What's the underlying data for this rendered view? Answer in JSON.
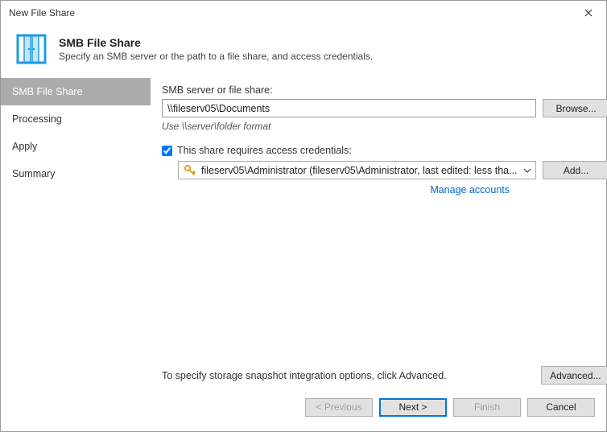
{
  "window": {
    "title": "New File Share"
  },
  "header": {
    "title": "SMB File Share",
    "subtitle": "Specify an SMB server or the path to a file share, and access credentials."
  },
  "sidebar": {
    "items": [
      {
        "label": "SMB File Share",
        "active": true
      },
      {
        "label": "Processing",
        "active": false
      },
      {
        "label": "Apply",
        "active": false
      },
      {
        "label": "Summary",
        "active": false
      }
    ]
  },
  "main": {
    "path_label": "SMB server or file share:",
    "path_value": "\\\\fileserv05\\Documents",
    "browse_label": "Browse...",
    "format_hint": "Use \\\\server\\folder format",
    "creds_checkbox_label": "This share requires access credentials:",
    "creds_checked": true,
    "creds_selected": "fileserv05\\Administrator (fileserv05\\Administrator, last edited: less tha...",
    "add_label": "Add...",
    "manage_label": "Manage accounts",
    "advanced_hint": "To specify storage snapshot integration options, click Advanced.",
    "advanced_label": "Advanced..."
  },
  "footer": {
    "previous": "< Previous",
    "next": "Next >",
    "finish": "Finish",
    "cancel": "Cancel"
  }
}
